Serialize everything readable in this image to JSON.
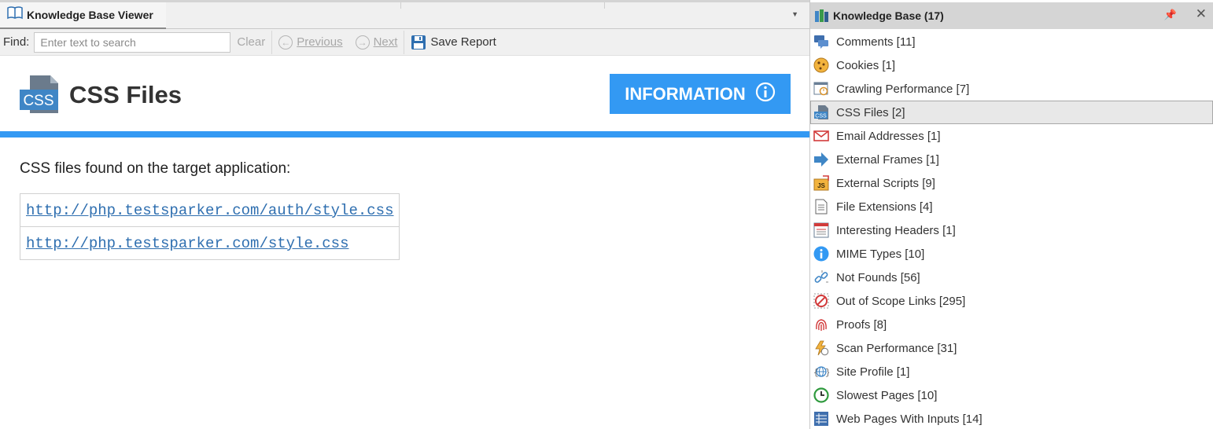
{
  "left_pane": {
    "tab_title": "Knowledge Base Viewer",
    "toolbar": {
      "find_label": "Find:",
      "search_placeholder": "Enter text to search",
      "search_value": "",
      "clear_label": "Clear",
      "previous_label": "Previous",
      "next_label": "Next",
      "save_report_label": "Save Report"
    },
    "header": {
      "title": "CSS Files",
      "icon_text": "CSS",
      "severity_label": "INFORMATION"
    },
    "content": {
      "description": "CSS files found on the target application:",
      "urls": [
        "http://php.testsparker.com/auth/style.css",
        "http://php.testsparker.com/style.css"
      ]
    }
  },
  "right_pane": {
    "title": "Knowledge Base (17)",
    "items": [
      {
        "label": "Comments [11]",
        "icon": "comments-icon"
      },
      {
        "label": "Cookies [1]",
        "icon": "cookie-icon"
      },
      {
        "label": "Crawling Performance [7]",
        "icon": "crawling-performance-icon"
      },
      {
        "label": "CSS Files [2]",
        "icon": "css-file-icon"
      },
      {
        "label": "Email Addresses [1]",
        "icon": "email-icon"
      },
      {
        "label": "External Frames [1]",
        "icon": "arrow-right-icon"
      },
      {
        "label": "External Scripts [9]",
        "icon": "js-script-icon"
      },
      {
        "label": "File Extensions [4]",
        "icon": "document-icon"
      },
      {
        "label": "Interesting Headers [1]",
        "icon": "headers-icon"
      },
      {
        "label": "MIME Types [10]",
        "icon": "info-icon"
      },
      {
        "label": "Not Founds [56]",
        "icon": "broken-link-icon"
      },
      {
        "label": "Out of Scope Links [295]",
        "icon": "no-entry-icon"
      },
      {
        "label": "Proofs [8]",
        "icon": "fingerprint-icon"
      },
      {
        "label": "Scan Performance [31]",
        "icon": "lightning-icon"
      },
      {
        "label": "Site Profile [1]",
        "icon": "globe-icon"
      },
      {
        "label": "Slowest Pages [10]",
        "icon": "clock-icon"
      },
      {
        "label": "Web Pages With Inputs [14]",
        "icon": "form-icon"
      }
    ],
    "selected_index": 3
  },
  "colors": {
    "accent_blue": "#3399f3",
    "link_blue": "#2f6fb0",
    "selection_bg": "#e8e8e8"
  }
}
